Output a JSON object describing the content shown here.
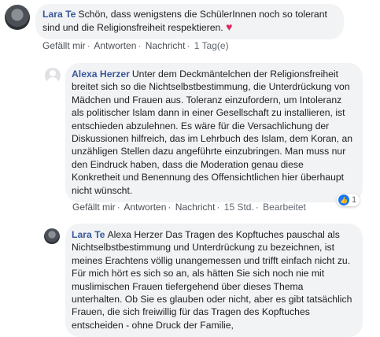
{
  "comments": [
    {
      "author": "Lara Te",
      "text": "Schön, dass wenigstens die SchülerInnen noch so tolerant sind und die Religionsfreiheit respektieren.",
      "emoji": "♥",
      "actions": {
        "like": "Gefällt mir",
        "reply": "Antworten",
        "message": "Nachricht",
        "time": "1 Tag(e)"
      }
    },
    {
      "author": "Alexa Herzer",
      "text": "Unter dem Deckmäntelchen der Religionsfreiheit breitet sich so die Nichtselbstbestimmung, die Unterdrückung von Mädchen und Frauen aus. Toleranz einzufordern, um Intoleranz als politischer Islam dann in einer Gesellschaft zu installieren, ist entschieden abzulehnen. Es wäre für die Versachlichung der Diskussionen hilfreich, das im Lehrbuch des Islam, dem Koran, an unzähligen Stellen dazu angeführte einzubringen. Man muss nur den Eindruck haben, dass die Moderation genau diese Konkretheit und Benennung des Offensichtlichen hier überhaupt nicht wünscht.",
      "reaction_count": "1",
      "actions": {
        "like": "Gefällt mir",
        "reply": "Antworten",
        "message": "Nachricht",
        "time": "15 Std.",
        "edited": "Bearbeitet"
      }
    },
    {
      "author": "Lara Te",
      "text": "Alexa Herzer Das Tragen des Kopftuches pauschal als Nichtselbstbestimmung und Unterdrückung zu bezeichnen, ist meines Erachtens völlig unangemessen und trifft einfach nicht zu. Für mich hört es sich so an, als hätten Sie sich noch nie mit muslimischen Frauen tiefergehend über dieses Thema unterhalten. Ob Sie es glauben oder nicht, aber es gibt tatsächlich Frauen, die sich freiwillig für das Tragen des Kopftuches entscheiden - ohne Druck der Familie,"
    }
  ]
}
